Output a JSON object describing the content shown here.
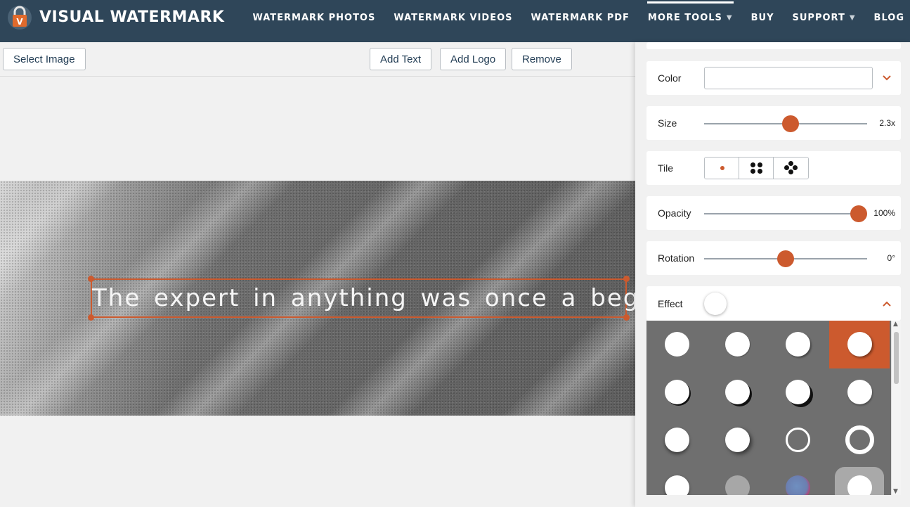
{
  "header": {
    "brand": "VISUAL WATERMARK",
    "nav": [
      {
        "label": "WATERMARK PHOTOS",
        "caret": false,
        "active": false
      },
      {
        "label": "WATERMARK VIDEOS",
        "caret": false,
        "active": false
      },
      {
        "label": "WATERMARK PDF",
        "caret": false,
        "active": false
      },
      {
        "label": "MORE TOOLS",
        "caret": true,
        "active": true
      },
      {
        "label": "BUY",
        "caret": false,
        "active": false
      },
      {
        "label": "SUPPORT",
        "caret": true,
        "active": false
      },
      {
        "label": "BLOG",
        "caret": false,
        "active": false
      }
    ],
    "caret_glyph": "▼"
  },
  "toolbar": {
    "select_image": "Select Image",
    "add_text": "Add Text",
    "add_logo": "Add Logo",
    "remove": "Remove"
  },
  "canvas": {
    "watermark_text": "The expert in anything was once a beginner"
  },
  "panel": {
    "color": {
      "label": "Color",
      "value": ""
    },
    "size": {
      "label": "Size",
      "value_text": "2.3x",
      "level": 0.53
    },
    "tile": {
      "label": "Tile",
      "options": [
        "single",
        "grid",
        "cross"
      ],
      "selected": "single"
    },
    "opacity": {
      "label": "Opacity",
      "value_text": "100%",
      "level": 1.0
    },
    "rotation": {
      "label": "Rotation",
      "value_text": "0°",
      "level": 0.5
    },
    "effect": {
      "label": "Effect",
      "enabled": false,
      "selected_index": 3
    }
  },
  "colors": {
    "accent": "#cc5a2e",
    "header_bg": "#2f4659"
  }
}
